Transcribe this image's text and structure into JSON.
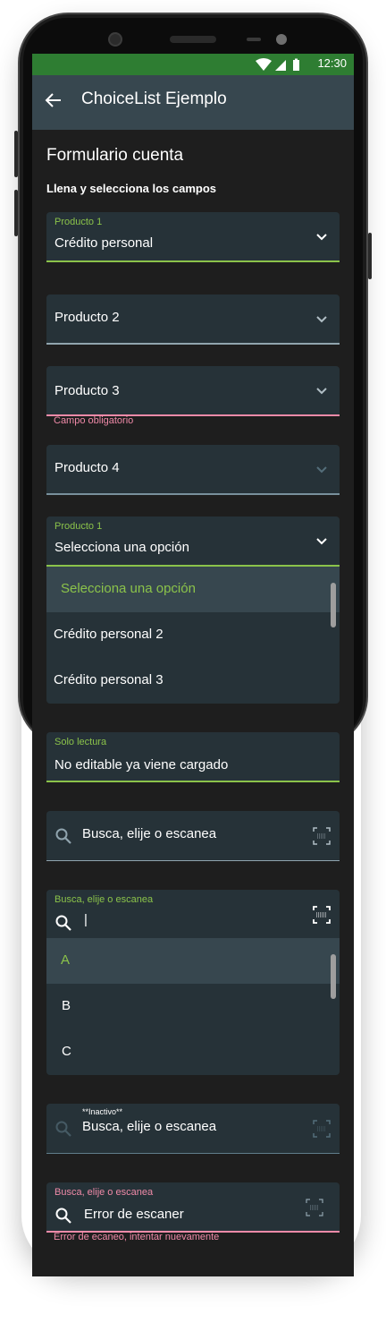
{
  "status_bar": {
    "time": "12:30"
  },
  "app_bar": {
    "title": "ChoiceList Ejemplo"
  },
  "form": {
    "title": "Formulario cuenta",
    "subtitle": "Llena y selecciona los campos"
  },
  "fields": {
    "producto1": {
      "label": "Producto 1",
      "value": "Crédito personal"
    },
    "producto2": {
      "value": "Producto 2"
    },
    "producto3": {
      "value": "Producto 3",
      "error": "Campo obligatorio"
    },
    "producto4": {
      "value": "Producto 4"
    },
    "producto1_open": {
      "label": "Producto 1",
      "value": "Selecciona una opción",
      "options": [
        "Selecciona una opción",
        "Crédito personal 2",
        "Crédito personal 3"
      ]
    },
    "readonly": {
      "label": "Solo lectura",
      "value": "No editable ya viene cargado"
    },
    "search1": {
      "placeholder": "Busca, elije o escanea"
    },
    "search_open": {
      "label": "Busca, elije o escanea",
      "value": "|",
      "options": [
        "A",
        "B",
        "C"
      ]
    },
    "search_inactive": {
      "label": "**Inactivo**",
      "value": "Busca, elije o escanea"
    },
    "search_error": {
      "label": "Busca, elije o escanea",
      "value": "Error de escaner",
      "error": "Error de ecaneo, intentar nuevamente"
    }
  },
  "colors": {
    "accent_green": "#8bc34a",
    "error_pink": "#ef8aa8",
    "field_bg": "#263238",
    "appbar_bg": "#37474f",
    "statusbar_bg": "#2e7d32"
  }
}
